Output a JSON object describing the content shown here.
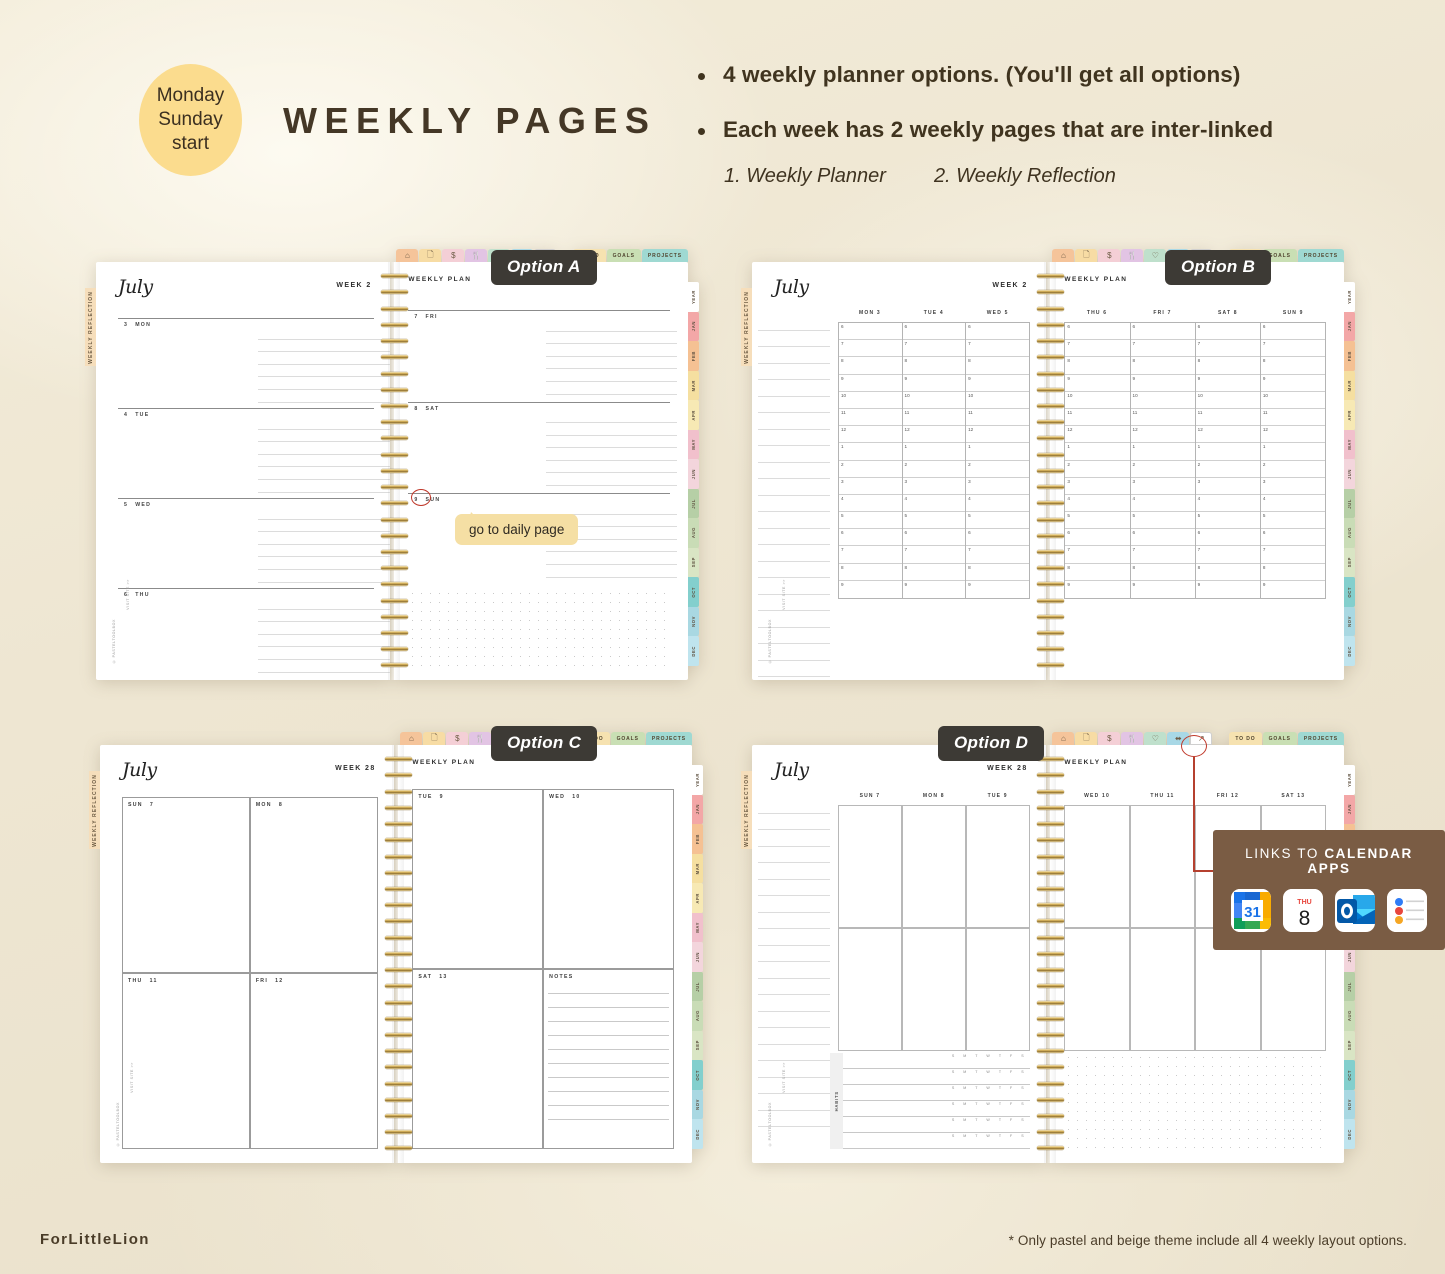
{
  "header": {
    "badge_lines": [
      "Monday",
      "Sunday",
      "start"
    ],
    "title": "WEEKLY PAGES",
    "bullets": [
      "4 weekly planner options. (You'll get all options)",
      "Each week has 2 weekly pages that are inter-linked"
    ],
    "sublist": [
      "1. Weekly Planner",
      "2. Weekly Reflection"
    ]
  },
  "footer": {
    "brand": "ForLittleLion",
    "note": "* Only pastel and beige theme include all 4 weekly layout options."
  },
  "common": {
    "month": "July",
    "weekly_plan_label": "WEEKLY PLAN",
    "reflection_tab": "WEEKLY REFLECTION",
    "copyright": "© PASTELTOOLBOX",
    "visit_note": "VISIT SITE >>",
    "notes_label": "NOTES",
    "habits_label": "HABITS",
    "habit_days": [
      "S",
      "M",
      "T",
      "W",
      "T",
      "F",
      "S"
    ],
    "toolbar_icons": [
      "home-icon",
      "page-icon",
      "finance-icon",
      "meal-icon",
      "health-icon",
      "fitness-icon",
      "link-icon"
    ],
    "toolbar_tabs": [
      "TO DO",
      "GOALS",
      "PROJECTS"
    ],
    "month_tabs": [
      "YEAR",
      "JAN",
      "FEB",
      "MAR",
      "APR",
      "MAY",
      "JUN",
      "JUL",
      "AUG",
      "SEP",
      "OCT",
      "NOV",
      "DEC"
    ],
    "month_tab_colors": [
      "#ffffff",
      "#f3a7a7",
      "#f5c193",
      "#f5dfa0",
      "#f7e9b4",
      "#f1c0cc",
      "#f3d5dc",
      "#b6cfa6",
      "#c9dcb6",
      "#d9e5c4",
      "#83cfcd",
      "#a9d8e2",
      "#bfe4ee"
    ],
    "toolbar_icon_colors": [
      "#f5c49a",
      "#f7dca4",
      "#f4cfd6",
      "#e2c4e4",
      "#bfe0cc",
      "#a8d8e6",
      "#ffffff"
    ],
    "toolbar_tab_colors": [
      "#f6e2b0",
      "#c9dfb4",
      "#9fd9d2"
    ]
  },
  "options": [
    {
      "chip": "Option A",
      "week": "WEEK 2",
      "layout": "lined-days",
      "left_days": [
        {
          "num": "3",
          "name": "MON"
        },
        {
          "num": "4",
          "name": "TUE"
        },
        {
          "num": "5",
          "name": "WED"
        },
        {
          "num": "6",
          "name": "THU"
        }
      ],
      "right_days": [
        {
          "num": "7",
          "name": "FRI"
        },
        {
          "num": "8",
          "name": "SAT"
        },
        {
          "num": "9",
          "name": "SUN"
        }
      ],
      "tooltip": "go to daily page"
    },
    {
      "chip": "Option B",
      "week": "WEEK 2",
      "layout": "hourly",
      "left_days": [
        {
          "num": "3",
          "name": "MON"
        },
        {
          "num": "4",
          "name": "TUE"
        },
        {
          "num": "5",
          "name": "WED"
        }
      ],
      "right_days": [
        {
          "num": "6",
          "name": "THU"
        },
        {
          "num": "7",
          "name": "FRI"
        },
        {
          "num": "8",
          "name": "SAT"
        },
        {
          "num": "9",
          "name": "SUN"
        }
      ],
      "hours": [
        "6",
        "7",
        "8",
        "9",
        "10",
        "11",
        "12",
        "1",
        "2",
        "3",
        "4",
        "5",
        "6",
        "7",
        "8",
        "9"
      ]
    },
    {
      "chip": "Option C",
      "week": "WEEK 28",
      "layout": "boxes",
      "left_days": [
        {
          "num": "7",
          "name": "SUN"
        },
        {
          "num": "8",
          "name": "MON"
        },
        {
          "num": "11",
          "name": "THU"
        },
        {
          "num": "12",
          "name": "FRI"
        }
      ],
      "right_days": [
        {
          "num": "9",
          "name": "TUE"
        },
        {
          "num": "10",
          "name": "WED"
        },
        {
          "num": "13",
          "name": "SAT"
        },
        {
          "num": "",
          "name": "NOTES"
        }
      ]
    },
    {
      "chip": "Option D",
      "week": "WEEK 28",
      "layout": "calendar",
      "left_days": [
        {
          "num": "7",
          "name": "SUN"
        },
        {
          "num": "8",
          "name": "MON"
        },
        {
          "num": "9",
          "name": "TUE"
        }
      ],
      "right_days": [
        {
          "num": "10",
          "name": "WED"
        },
        {
          "num": "11",
          "name": "THU"
        },
        {
          "num": "12",
          "name": "FRI"
        },
        {
          "num": "13",
          "name": "SAT"
        }
      ]
    }
  ],
  "calendar_panel": {
    "title_plain": "LINKS TO ",
    "title_bold": "CALENDAR APPS",
    "apps": [
      {
        "name": "google-calendar-icon",
        "label": "31"
      },
      {
        "name": "apple-calendar-icon",
        "label": "8",
        "sub": "THU"
      },
      {
        "name": "outlook-icon",
        "label": "O"
      },
      {
        "name": "reminders-icon",
        "label": ""
      }
    ]
  }
}
